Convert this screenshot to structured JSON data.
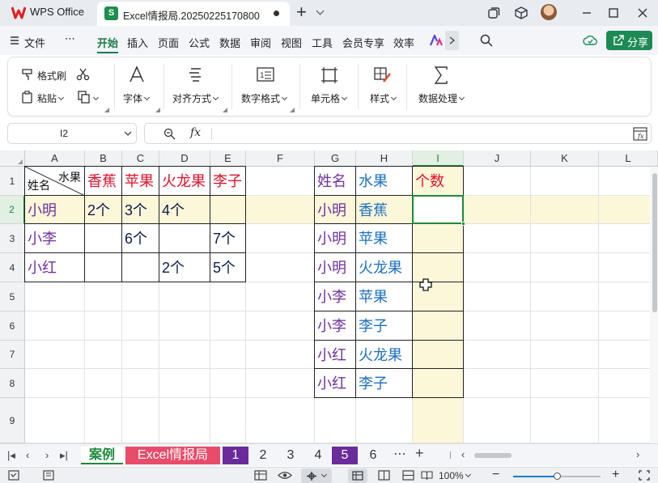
{
  "titlebar": {
    "app_name": "WPS Office",
    "doc_title": "Excel情报局.20250225170800",
    "icon_letter": "S"
  },
  "menu": {
    "file": "文件",
    "more": "⋯",
    "items": [
      "开始",
      "插入",
      "页面",
      "公式",
      "数据",
      "审阅",
      "视图",
      "工具",
      "会员专享",
      "效率"
    ],
    "active": "开始",
    "share": "分享"
  },
  "ribbon": {
    "format_painter": "格式刷",
    "paste": "粘贴",
    "font": "字体",
    "align": "对齐方式",
    "number_format": "数字格式",
    "cell": "单元格",
    "style": "样式",
    "data_process": "数据处理"
  },
  "formula_bar": {
    "name_box": "I2",
    "fx": "fx",
    "content": ""
  },
  "grid": {
    "columns": [
      "A",
      "B",
      "C",
      "D",
      "E",
      "F",
      "G",
      "H",
      "I",
      "J",
      "K",
      "L"
    ],
    "rows": [
      "1",
      "2",
      "3",
      "4",
      "5",
      "6",
      "7",
      "8",
      "9"
    ],
    "selected_cell": "I2",
    "colors": {
      "purple": "#7030a0",
      "red": "#e0102a",
      "navy": "#0d1b4d",
      "blue": "#1b70c0",
      "highlight": "#fcf7d9",
      "selection": "#1d8a3a"
    },
    "left_table": {
      "corner_top": "水果",
      "corner_bottom": "姓名",
      "header": [
        "香蕉",
        "苹果",
        "火龙果",
        "李子"
      ],
      "rows": [
        {
          "name": "小明",
          "values": [
            "2个",
            "3个",
            "4个",
            ""
          ]
        },
        {
          "name": "小李",
          "values": [
            "",
            "6个",
            "",
            "7个"
          ]
        },
        {
          "name": "小红",
          "values": [
            "",
            "",
            "2个",
            "5个"
          ]
        }
      ]
    },
    "right_table": {
      "header": [
        "姓名",
        "水果",
        "个数"
      ],
      "rows": [
        [
          "小明",
          "香蕉"
        ],
        [
          "小明",
          "苹果"
        ],
        [
          "小明",
          "火龙果"
        ],
        [
          "小李",
          "苹果"
        ],
        [
          "小李",
          "李子"
        ],
        [
          "小红",
          "火龙果"
        ],
        [
          "小红",
          "李子"
        ]
      ]
    }
  },
  "sheets": {
    "tabs": [
      "案例",
      "Excel情报局",
      "1",
      "2",
      "3",
      "4",
      "5",
      "6"
    ],
    "active": "案例",
    "more": "⋯",
    "add": "+"
  },
  "status": {
    "zoom": "100%"
  }
}
